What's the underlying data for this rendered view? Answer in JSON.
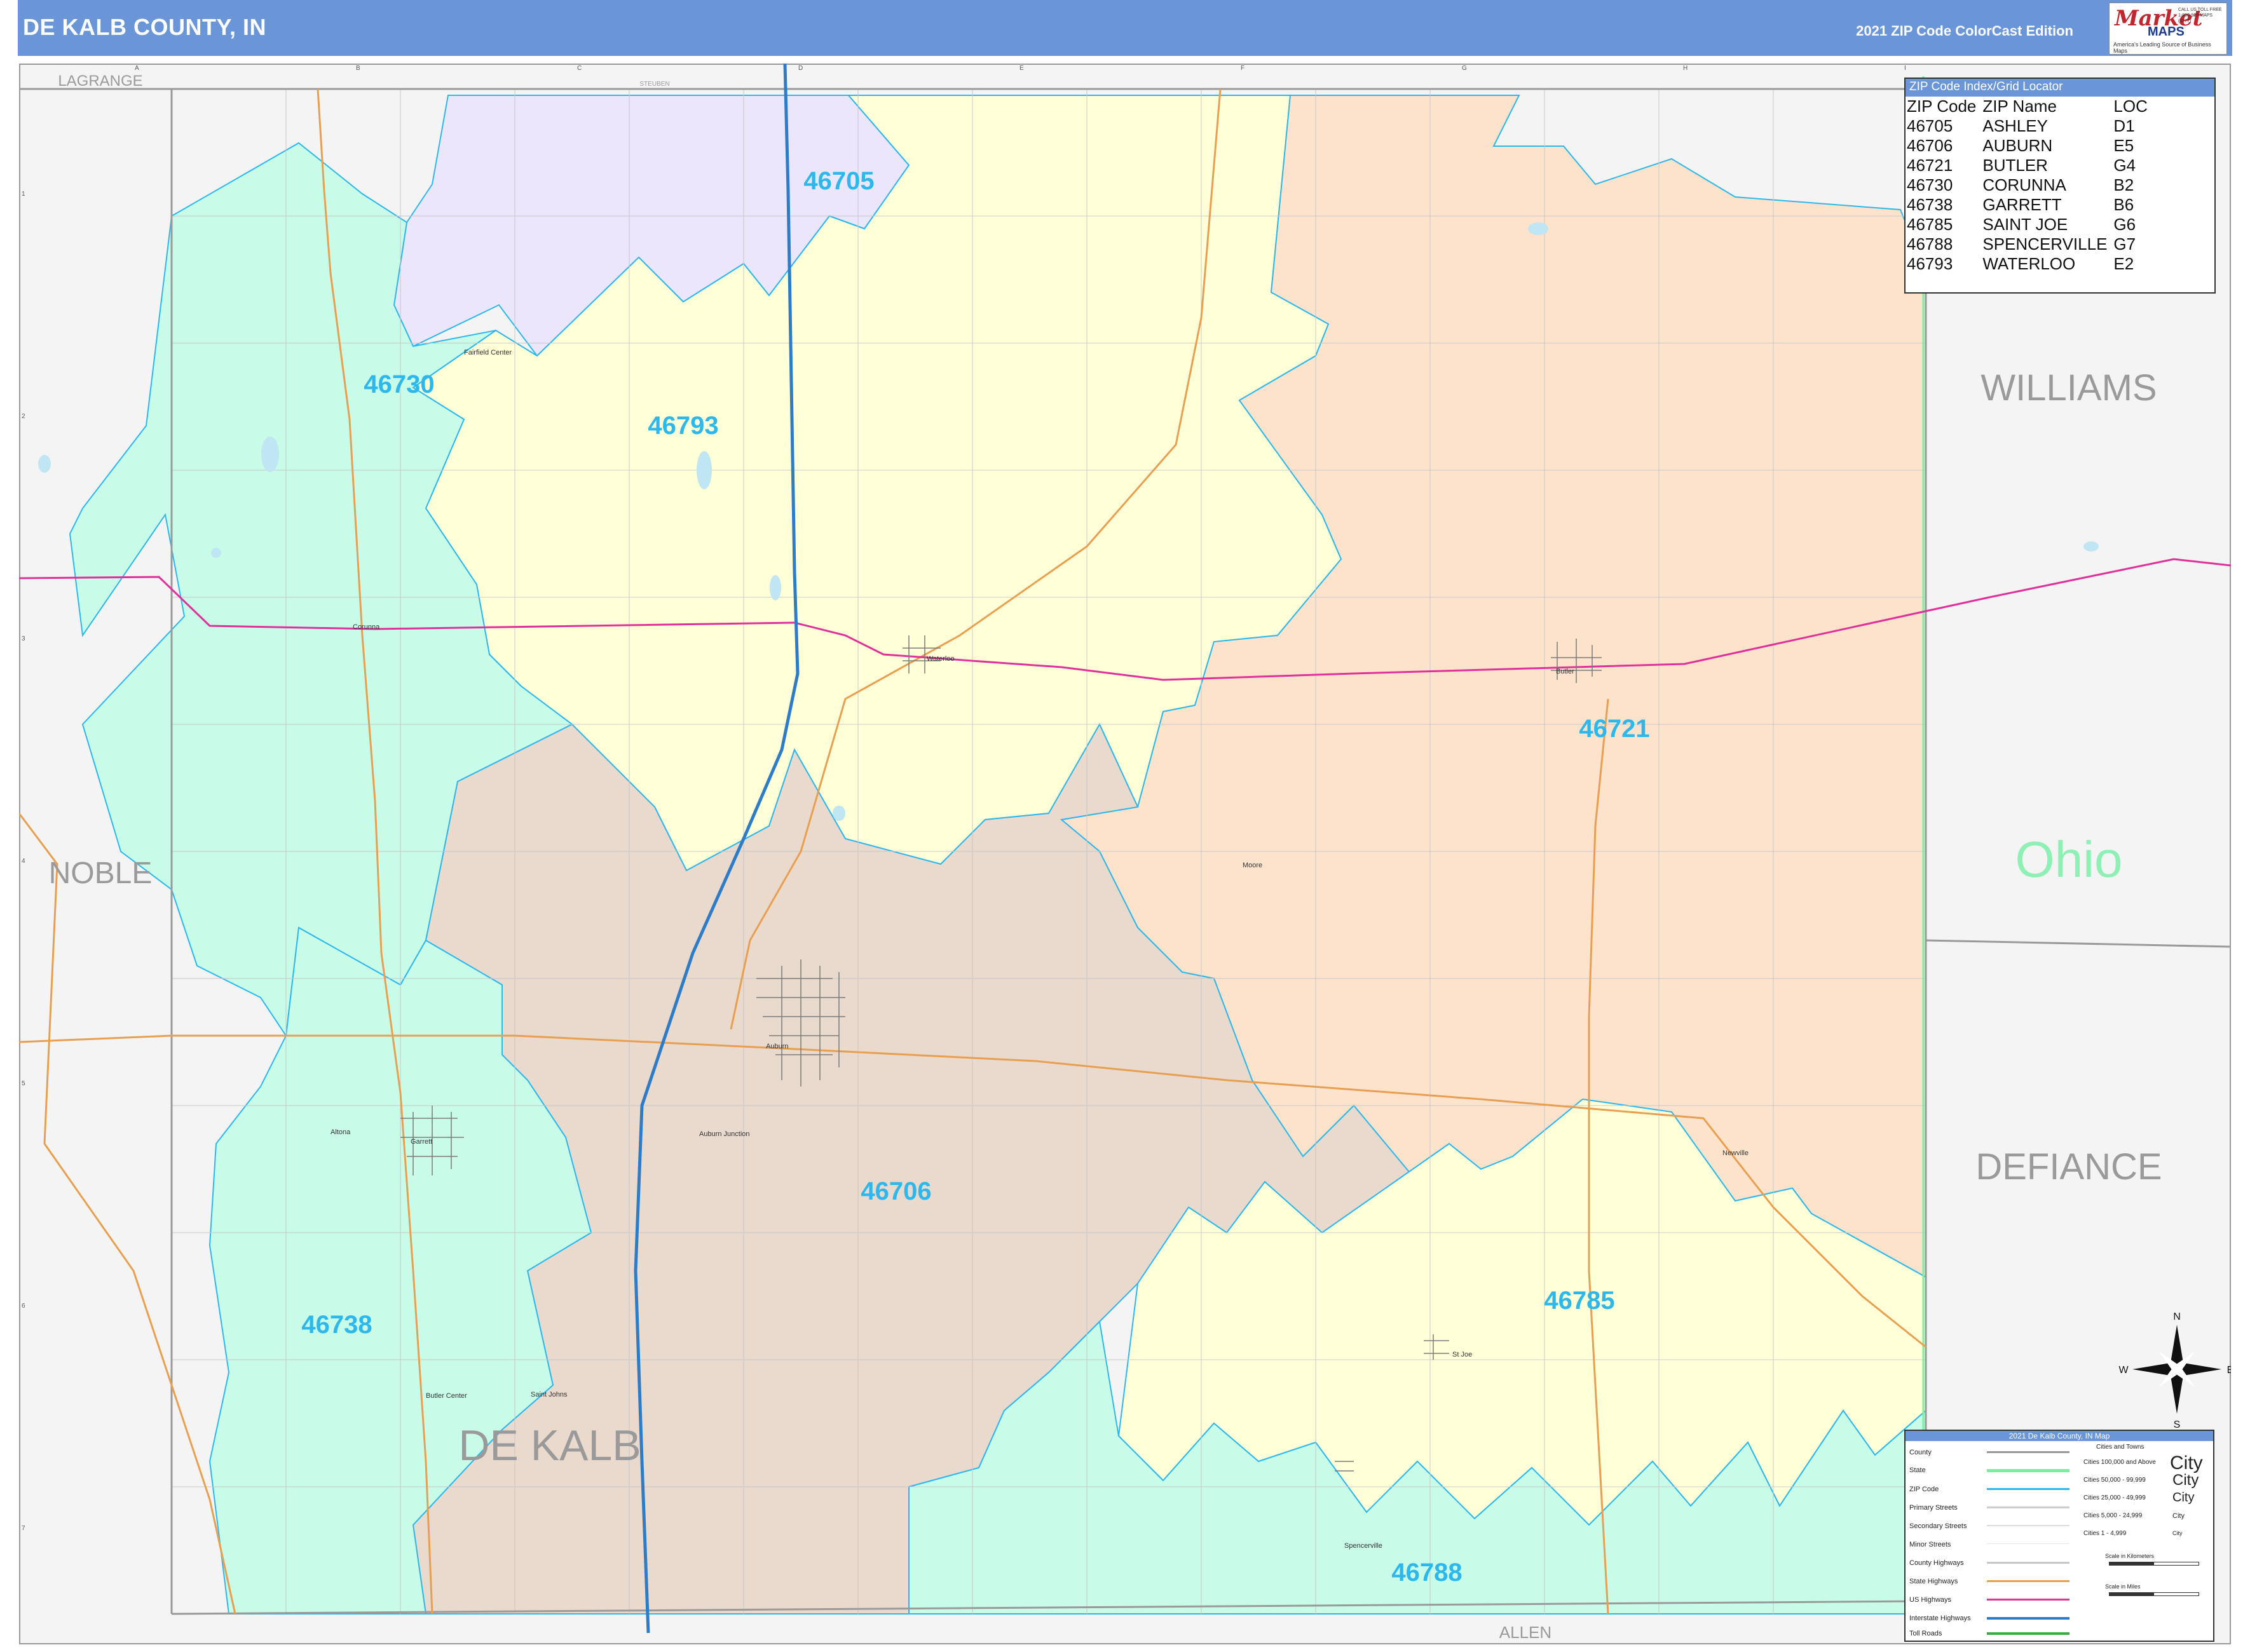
{
  "header": {
    "title": "DE KALB COUNTY, IN",
    "edition": "2021 ZIP Code ColorCast Edition",
    "logo_text_1": "Market",
    "logo_text_2": "MAPS",
    "logo_tagline": "America's Leading Source of Business Maps",
    "logo_phone": "CALL US TOLL FREE 1-800-929-MAPS (6277)"
  },
  "grid": {
    "columns": [
      "A",
      "B",
      "C",
      "D",
      "E",
      "F",
      "G",
      "H",
      "I"
    ],
    "rows": [
      "1",
      "2",
      "3",
      "4",
      "5",
      "6",
      "7"
    ]
  },
  "neighbor_counties": {
    "lagrange": "LAGRANGE",
    "steuben": "STEUBEN",
    "noble": "NOBLE",
    "williams": "WILLIAMS",
    "defiance": "DEFIANCE",
    "allen": "ALLEN",
    "state_ohio": "Ohio",
    "county_name": "DE KALB"
  },
  "zip_labels": {
    "z46705": "46705",
    "z46706": "46706",
    "z46721": "46721",
    "z46730": "46730",
    "z46738": "46738",
    "z46785": "46785",
    "z46788": "46788",
    "z46793": "46793"
  },
  "zip_colors": {
    "46705": "#ebe6fb",
    "46706": "#ead9cd",
    "46721": "#fde3cc",
    "46730": "#c9fbe9",
    "46738": "#c9fbe9",
    "46785": "#ffffd8",
    "46788": "#c9fbe9",
    "46793": "#ffffd8"
  },
  "cities": {
    "fairfield_center": "Fairfield Center",
    "corunna": "Corunna",
    "waterloo": "Waterloo",
    "butler": "Butler",
    "moore": "Moore",
    "auburn": "Auburn",
    "auburn_junction": "Auburn Junction",
    "altona": "Altona",
    "garrett": "Garrett",
    "newville": "Newville",
    "st_joe": "St Joe",
    "butler_center": "Butler Center",
    "saint_johns": "Saint Johns",
    "spencerville": "Spencerville"
  },
  "zip_index": {
    "title": "ZIP Code Index/Grid Locator",
    "headers": [
      "ZIP Code",
      "ZIP Name",
      "LOC"
    ],
    "rows": [
      [
        "46705",
        "ASHLEY",
        "D1"
      ],
      [
        "46706",
        "AUBURN",
        "E5"
      ],
      [
        "46721",
        "BUTLER",
        "G4"
      ],
      [
        "46730",
        "CORUNNA",
        "B2"
      ],
      [
        "46738",
        "GARRETT",
        "B6"
      ],
      [
        "46785",
        "SAINT JOE",
        "G6"
      ],
      [
        "46788",
        "SPENCERVILLE",
        "G7"
      ],
      [
        "46793",
        "WATERLOO",
        "E2"
      ]
    ]
  },
  "legend": {
    "title": "2021 De Kalb County, IN Map",
    "items": [
      "County",
      "State",
      "ZIP Code",
      "Primary Streets",
      "Secondary Streets",
      "Minor Streets",
      "County Highways",
      "State Highways",
      "US Highways",
      "Interstate Highways",
      "Toll Roads"
    ],
    "city_header": "Cities and Towns",
    "city_sizes": [
      "Cities 100,000 and Above",
      "Cities 50,000 - 99,999",
      "Cities 25,000 - 49,999",
      "Cities 5,000 - 24,999",
      "Cities 1 - 4,999"
    ],
    "city_samples": [
      "City",
      "City",
      "City",
      "City",
      "City"
    ],
    "scale_km": "Scale in Kilometers",
    "scale_mi": "Scale in Miles",
    "colors": {
      "county": "#9a9a9a",
      "state": "#7cf0a0",
      "zip": "#2cb8ec",
      "state_hwy": "#e8a050",
      "us_hwy": "#e0309c",
      "interstate": "#2c7cc8",
      "toll": "#30b040"
    }
  },
  "compass": {
    "n": "N",
    "s": "S",
    "e": "E",
    "w": "W"
  }
}
